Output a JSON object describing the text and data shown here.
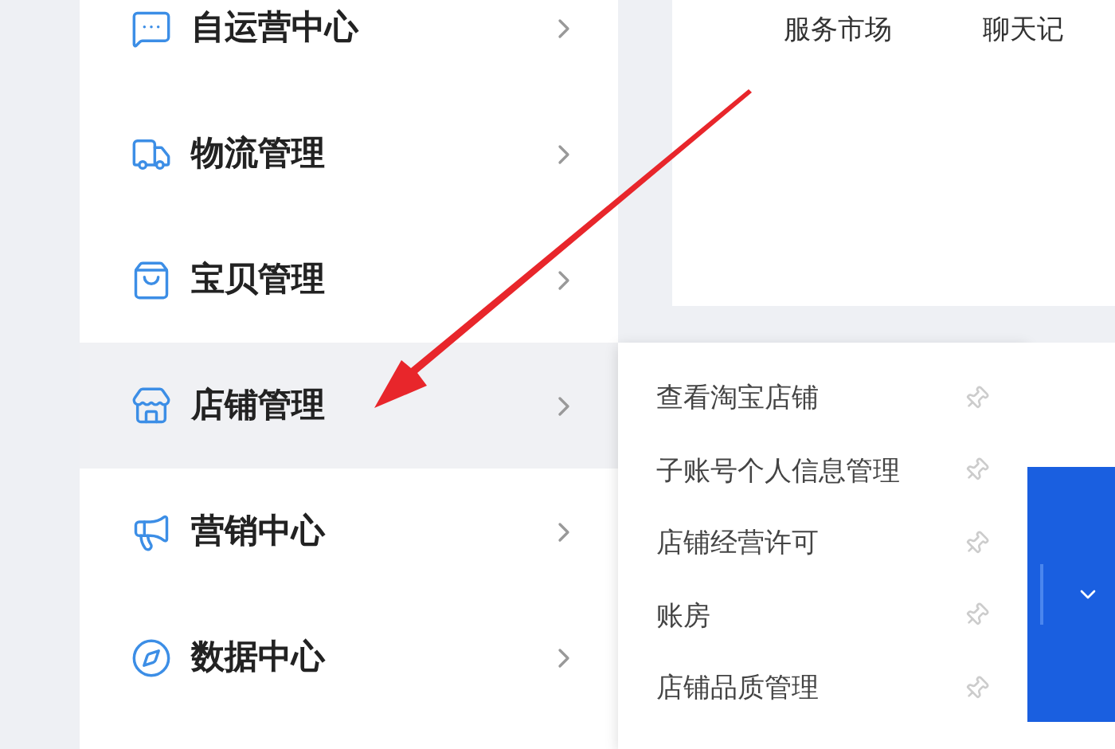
{
  "sidebar": {
    "items": [
      {
        "label": "自运营中心",
        "selected": false
      },
      {
        "label": "物流管理",
        "selected": false
      },
      {
        "label": "宝贝管理",
        "selected": false
      },
      {
        "label": "店铺管理",
        "selected": true
      },
      {
        "label": "营销中心",
        "selected": false
      },
      {
        "label": "数据中心",
        "selected": false
      }
    ]
  },
  "top_links": [
    "服务市场",
    "聊天记"
  ],
  "submenu": {
    "items": [
      {
        "label": "查看淘宝店铺"
      },
      {
        "label": "子账号个人信息管理"
      },
      {
        "label": "店铺经营许可"
      },
      {
        "label": "账房"
      },
      {
        "label": "店铺品质管理"
      }
    ]
  }
}
